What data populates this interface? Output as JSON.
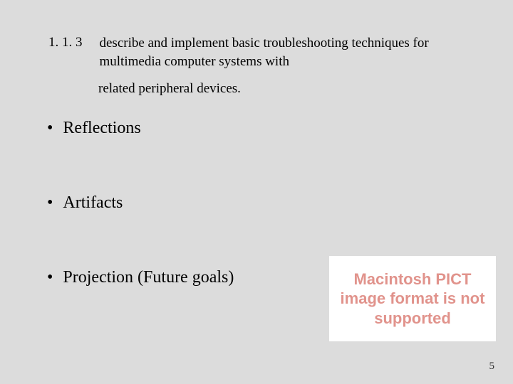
{
  "standard": {
    "number": "1. 1. 3",
    "description_line1": "describe and implement basic troubleshooting techniques for multimedia computer systems with",
    "description_line2": "related peripheral devices."
  },
  "bullets": [
    {
      "label": "Reflections"
    },
    {
      "label": "Artifacts"
    },
    {
      "label": "Projection (Future goals)"
    }
  ],
  "pict_placeholder": {
    "message": "Macintosh PICT image format is not supported"
  },
  "page_number": "5"
}
